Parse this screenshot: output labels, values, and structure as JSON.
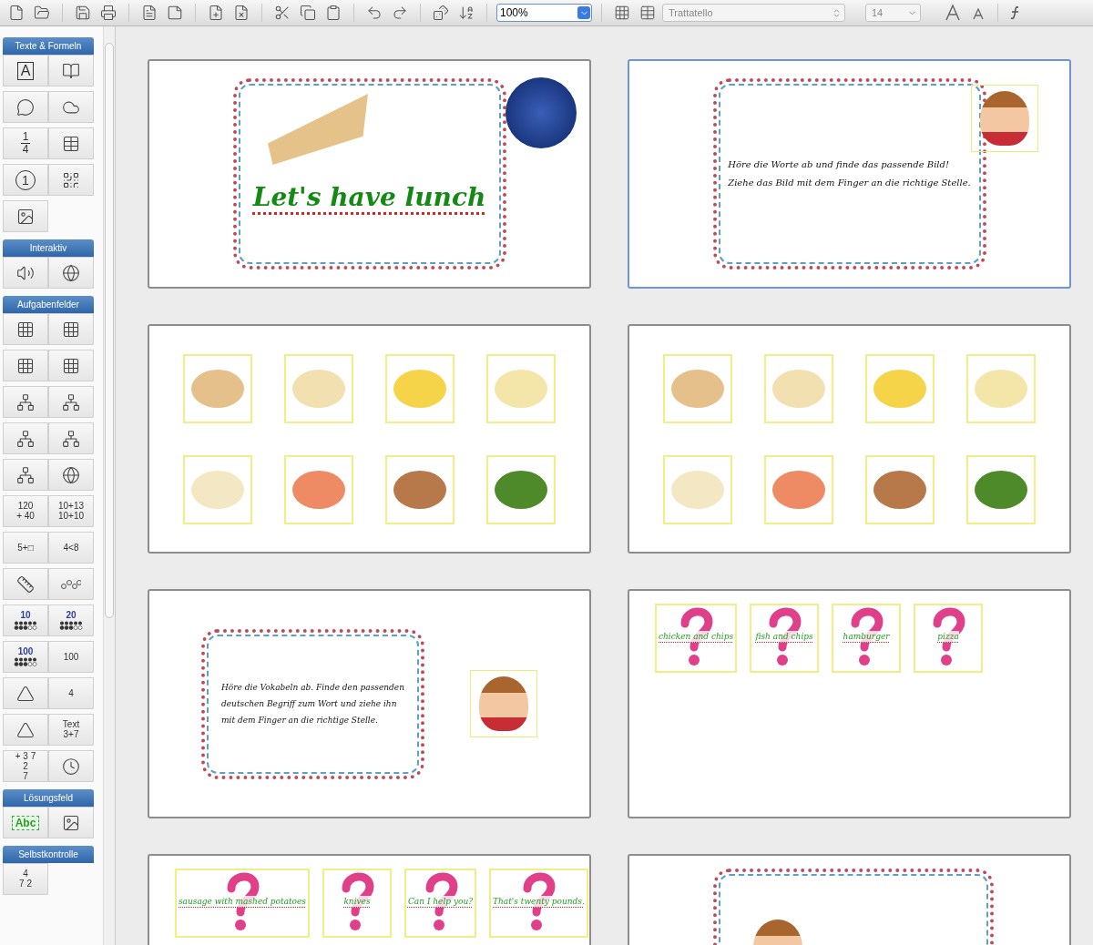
{
  "toolbar": {
    "zoom": "100%",
    "font": "Trattatello",
    "size": "14"
  },
  "sidebar": [
    {
      "title": "Texte & Formeln",
      "tiles": [
        {
          "kind": "boxed",
          "lines": [
            "A"
          ]
        },
        {
          "kind": "icon"
        },
        {
          "kind": "icon"
        },
        {
          "kind": "icon"
        },
        {
          "kind": "fraction",
          "lines": [
            "1",
            "4"
          ]
        },
        {
          "kind": "icon"
        },
        {
          "kind": "circled",
          "lines": [
            "1"
          ]
        },
        {
          "kind": "icon"
        },
        {
          "kind": "icon"
        }
      ]
    },
    {
      "title": "Interaktiv",
      "tiles": [
        {
          "kind": "icon"
        },
        {
          "kind": "icon"
        }
      ]
    },
    {
      "title": "Aufgabenfelder",
      "tiles": [
        {
          "kind": "icon"
        },
        {
          "kind": "icon"
        },
        {
          "kind": "icon"
        },
        {
          "kind": "icon"
        },
        {
          "kind": "icon"
        },
        {
          "kind": "icon"
        },
        {
          "kind": "icon"
        },
        {
          "kind": "icon"
        },
        {
          "kind": "icon"
        },
        {
          "kind": "icon"
        },
        {
          "kind": "text",
          "lines": [
            "120",
            "+ 40"
          ]
        },
        {
          "kind": "text",
          "lines": [
            "10+13",
            "10+10"
          ]
        },
        {
          "kind": "text",
          "lines": [
            "5+□"
          ]
        },
        {
          "kind": "text",
          "lines": [
            "4<8"
          ]
        },
        {
          "kind": "icon"
        },
        {
          "kind": "icon"
        },
        {
          "kind": "dots",
          "lines": [
            "10"
          ]
        },
        {
          "kind": "dots",
          "lines": [
            "20"
          ]
        },
        {
          "kind": "dots",
          "lines": [
            "100"
          ]
        },
        {
          "kind": "text",
          "lines": [
            "100"
          ]
        },
        {
          "kind": "icon"
        },
        {
          "kind": "text",
          "lines": [
            "4"
          ]
        },
        {
          "kind": "icon"
        },
        {
          "kind": "text",
          "lines": [
            "Text",
            "3+7"
          ]
        },
        {
          "kind": "text",
          "lines": [
            "+ 3 7",
            "2",
            "7"
          ]
        },
        {
          "kind": "icon"
        }
      ]
    },
    {
      "title": "Lösungsfeld",
      "tiles": [
        {
          "kind": "boxed",
          "lines": [
            "Abc"
          ]
        },
        {
          "kind": "icon"
        }
      ]
    },
    {
      "title": "Selbstkontrolle",
      "tiles": [
        {
          "kind": "text",
          "lines": [
            "4",
            "7   2"
          ]
        }
      ]
    }
  ],
  "slides": [
    {
      "kind": "title",
      "selected": false,
      "title": "Let's have lunch"
    },
    {
      "kind": "instruction_corner",
      "selected": true,
      "lines": [
        "Höre die Worte ab und finde das passende Bild!",
        "Ziehe das Bild mit dem Finger an die richtige Stelle."
      ]
    },
    {
      "kind": "pictures",
      "selected": false
    },
    {
      "kind": "pictures",
      "selected": false
    },
    {
      "kind": "instruction_side",
      "selected": false,
      "lines": [
        "Höre die Vokabeln ab. Finde den passenden",
        "deutschen Begriff zum Wort und ziehe ihn",
        "mit dem Finger an die richtige Stelle."
      ]
    },
    {
      "kind": "questions",
      "selected": false,
      "words": [
        "chicken and chips",
        "fish and chips",
        "hamburger",
        "pizza"
      ]
    },
    {
      "kind": "questions",
      "selected": false,
      "words": [
        "sausage with mashed potatoes",
        "knives",
        "Can I help you?",
        "That's twenty pounds."
      ]
    },
    {
      "kind": "instruction_top",
      "selected": false
    }
  ]
}
